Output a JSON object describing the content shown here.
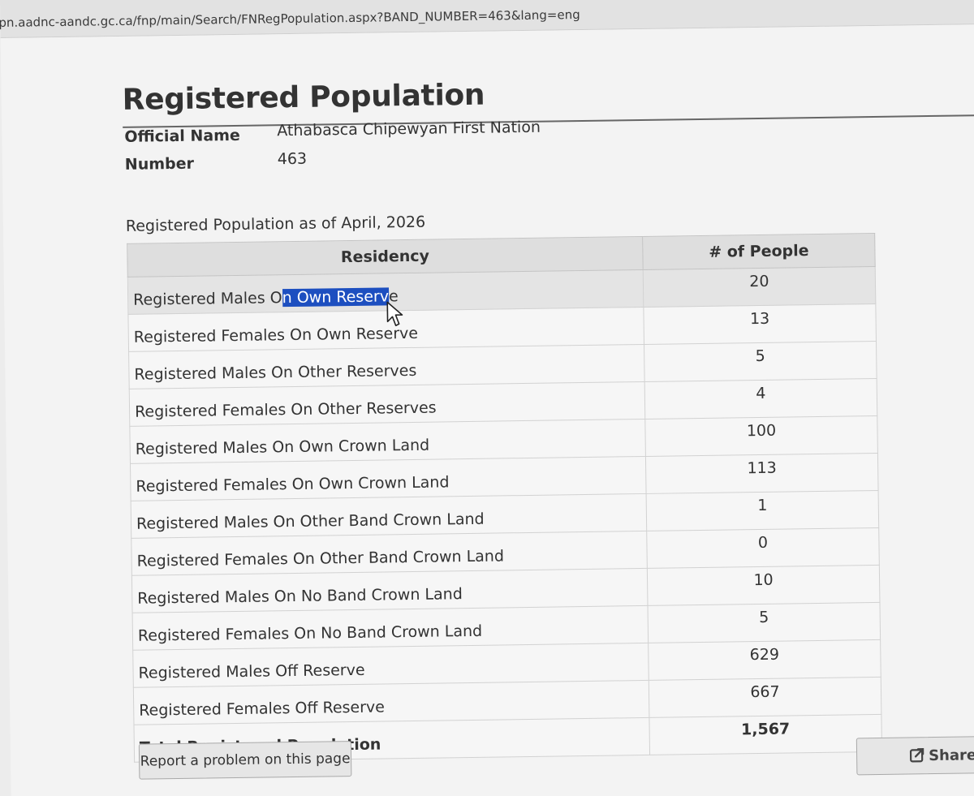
{
  "browser": {
    "url": "pn.aadnc-aandc.gc.ca/fnp/main/Search/FNRegPopulation.aspx?BAND_NUMBER=463&lang=eng"
  },
  "page": {
    "title": "Registered Population",
    "official_name_label": "Official Name",
    "official_name_value": "Athabasca Chipewyan First Nation",
    "number_label": "Number",
    "number_value": "463",
    "caption": "Registered Population as of April, 2026"
  },
  "table": {
    "headers": [
      "Residency",
      "# of People"
    ],
    "selection": {
      "before": "Registered Males O",
      "selected": "n Own Reserv",
      "after": "e"
    },
    "rows": [
      {
        "residency": "Registered Males On Own Reserve",
        "people": "20"
      },
      {
        "residency": "Registered Females On Own Reserve",
        "people": "13"
      },
      {
        "residency": "Registered Males On Other Reserves",
        "people": "5"
      },
      {
        "residency": "Registered Females On Other Reserves",
        "people": "4"
      },
      {
        "residency": "Registered Males On Own Crown Land",
        "people": "100"
      },
      {
        "residency": "Registered Females On Own Crown Land",
        "people": "113"
      },
      {
        "residency": "Registered Males On Other Band Crown Land",
        "people": "1"
      },
      {
        "residency": "Registered Females On Other Band Crown Land",
        "people": "0"
      },
      {
        "residency": "Registered Males On No Band Crown Land",
        "people": "10"
      },
      {
        "residency": "Registered Females On No Band Crown Land",
        "people": "5"
      },
      {
        "residency": "Registered Males Off Reserve",
        "people": "629"
      },
      {
        "residency": "Registered Females Off Reserve",
        "people": "667"
      }
    ],
    "total": {
      "residency": "Total Registered Population",
      "people": "1,567"
    }
  },
  "buttons": {
    "report": "Report a problem on this page",
    "share": "Share th",
    "share_icon": "share-icon"
  },
  "colors": {
    "selection": "#1d4fc0",
    "table_header": "#dedede"
  }
}
